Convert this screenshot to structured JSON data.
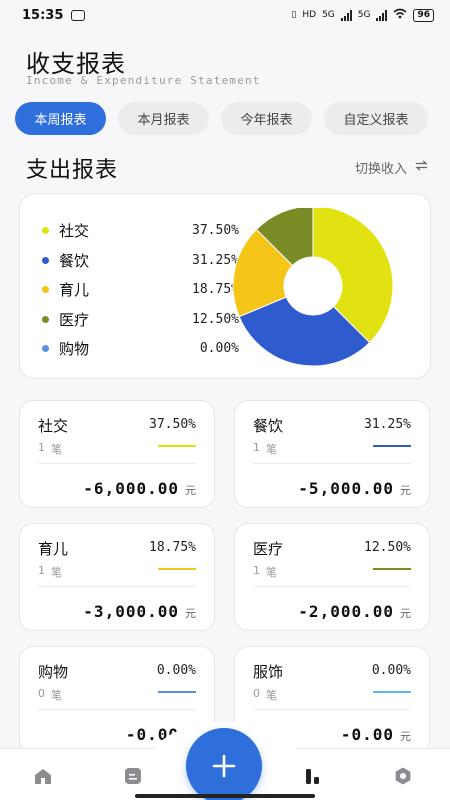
{
  "status_bar": {
    "time": "15:35",
    "network": [
      "HD",
      "5G",
      "5G"
    ],
    "battery": "96"
  },
  "header": {
    "title": "收支报表",
    "subtitle": "Income & Expenditure Statement"
  },
  "tabs": [
    {
      "label": "本周报表",
      "active": true
    },
    {
      "label": "本月报表",
      "active": false
    },
    {
      "label": "今年报表",
      "active": false
    },
    {
      "label": "自定义报表",
      "active": false
    }
  ],
  "section": {
    "title": "支出报表",
    "switch_label": "切换收入",
    "switch_icon": "swap-arrows-icon"
  },
  "chart_data": {
    "type": "pie",
    "style": "donut",
    "categories": [
      "社交",
      "餐饮",
      "育儿",
      "医疗",
      "购物"
    ],
    "values": [
      37.5,
      31.25,
      18.75,
      12.5,
      0.0
    ],
    "labels": [
      "37.50%",
      "31.25%",
      "18.75%",
      "12.50%",
      "0.00%"
    ],
    "colors": [
      "#e2e112",
      "#2e5bcd",
      "#f5c518",
      "#7a8a25",
      "#5b8fe0"
    ]
  },
  "categories": [
    {
      "name": "社交",
      "pct": "37.50%",
      "count": "1",
      "count_unit": "笔",
      "amount": "-6,000.00",
      "unit": "元",
      "color": "#e2e112"
    },
    {
      "name": "餐饮",
      "pct": "31.25%",
      "count": "1",
      "count_unit": "笔",
      "amount": "-5,000.00",
      "unit": "元",
      "color": "#2e5bcd"
    },
    {
      "name": "育儿",
      "pct": "18.75%",
      "count": "1",
      "count_unit": "笔",
      "amount": "-3,000.00",
      "unit": "元",
      "color": "#f5c518"
    },
    {
      "name": "医疗",
      "pct": "12.50%",
      "count": "1",
      "count_unit": "笔",
      "amount": "-2,000.00",
      "unit": "元",
      "color": "#7a8a25"
    },
    {
      "name": "购物",
      "pct": "0.00%",
      "count": "0",
      "count_unit": "笔",
      "amount": "-0.00",
      "unit": "元",
      "color": "#5b8fe0"
    },
    {
      "name": "服饰",
      "pct": "0.00%",
      "count": "0",
      "count_unit": "笔",
      "amount": "-0.00",
      "unit": "元",
      "color": "#5fb4e8"
    }
  ],
  "bottom_nav": {
    "items": [
      "home-icon",
      "bill-icon",
      "add-icon",
      "stats-icon",
      "settings-icon"
    ],
    "accent": "#2f6fdc"
  }
}
